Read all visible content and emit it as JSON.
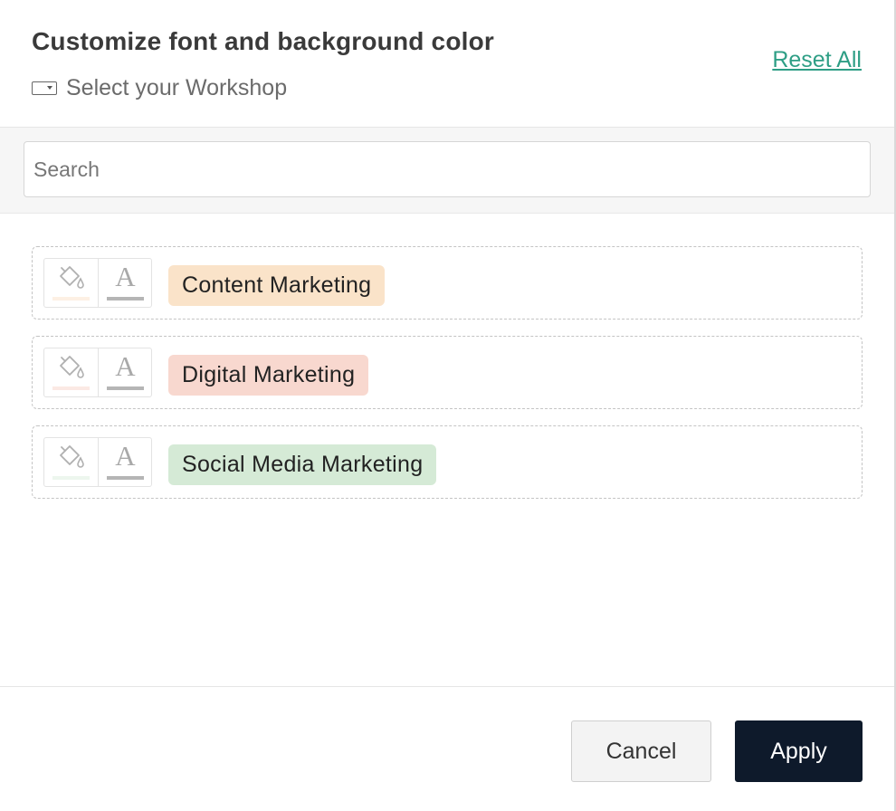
{
  "dialog": {
    "title": "Customize font and background color",
    "workshop_label": "Select your Workshop",
    "reset_label": "Reset All"
  },
  "search": {
    "placeholder": "Search",
    "value": ""
  },
  "items": [
    {
      "label": "Content Marketing",
      "tag_color": "#fae3c9",
      "swatch_color": "#fdf0e4",
      "font_swatch_color": "#b5b5b5"
    },
    {
      "label": "Digital Marketing",
      "tag_color": "#f8d8cf",
      "swatch_color": "#fbe9e4",
      "font_swatch_color": "#b5b5b5"
    },
    {
      "label": "Social Media Marketing",
      "tag_color": "#d5ead6",
      "swatch_color": "#edf6ee",
      "font_swatch_color": "#b5b5b5"
    }
  ],
  "icons": {
    "workshop": "dropdown-select-icon",
    "background": "paint-bucket-icon",
    "font": "font-color-icon",
    "font_glyph": "A"
  },
  "footer": {
    "cancel_label": "Cancel",
    "apply_label": "Apply"
  },
  "colors": {
    "accent_link": "#2e9e85",
    "primary_button": "#0e1a2b"
  }
}
